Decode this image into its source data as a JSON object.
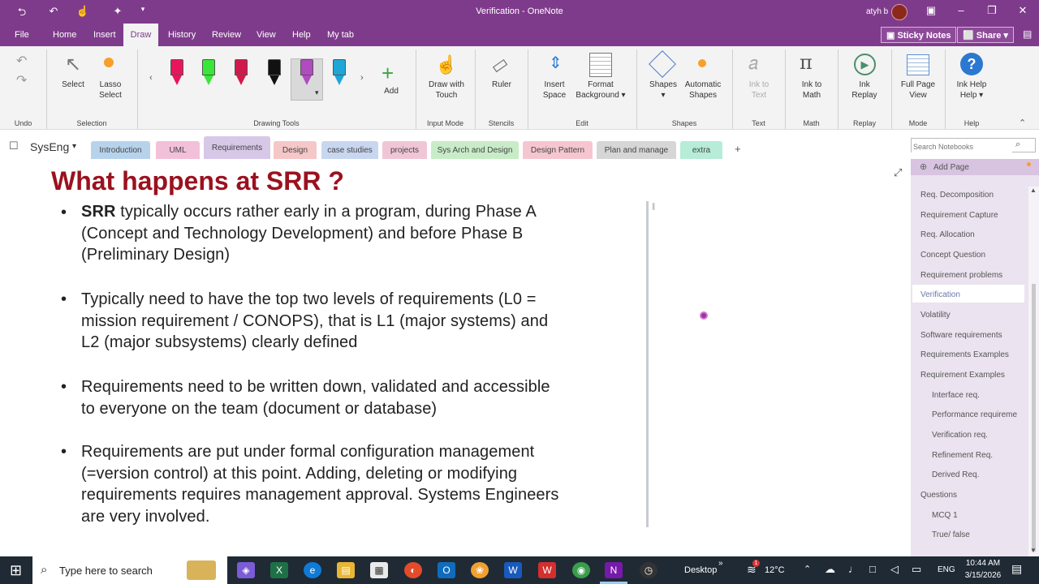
{
  "window": {
    "title": "Verification  -  OneNote",
    "user": "atyh b"
  },
  "menu_tabs": [
    "File",
    "Home",
    "Insert",
    "Draw",
    "History",
    "Review",
    "View",
    "Help",
    "My tab"
  ],
  "top_buttons": {
    "sticky_notes": "Sticky Notes",
    "share": "Share"
  },
  "ribbon": {
    "undo_group": "Undo",
    "select": "Select",
    "lasso_select": "Lasso Select",
    "selection_group": "Selection",
    "add": "Add",
    "drawing_tools_group": "Drawing Tools",
    "draw_with_touch": "Draw with Touch",
    "input_mode_group": "Input Mode",
    "ruler": "Ruler",
    "stencils_group": "Stencils",
    "insert_space": "Insert Space",
    "format_background": "Format Background",
    "edit_group": "Edit",
    "shapes": "Shapes",
    "automatic_shapes": "Automatic Shapes",
    "shapes_group": "Shapes",
    "ink_to_text": "Ink to Text",
    "text_group": "Text",
    "ink_to_math": "Ink to Math",
    "math_group": "Math",
    "ink_replay": "Ink Replay",
    "replay_group": "Replay",
    "full_page_view": "Full Page View",
    "mode_group": "Mode",
    "ink_help": "Ink Help",
    "help_group": "Help",
    "pen_colors": [
      "#e8155d",
      "#39e639",
      "#d11a4a",
      "#111111",
      "#b04cc0",
      "#1fa6d6"
    ]
  },
  "notebook": "SysEng",
  "section_tabs": [
    {
      "label": "Introduction",
      "color": "#b7d3ec"
    },
    {
      "label": "UML",
      "color": "#f3c0d9"
    },
    {
      "label": "Requirements",
      "color": "#d7c8e8"
    },
    {
      "label": "Design",
      "color": "#f5c7c7"
    },
    {
      "label": "case studies",
      "color": "#c8d6f0"
    },
    {
      "label": "projects",
      "color": "#f0c6d6"
    },
    {
      "label": "Sys Arch and Design",
      "color": "#c8ecc8"
    },
    {
      "label": "Design Pattern",
      "color": "#f6c6d0"
    },
    {
      "label": "Plan and manage",
      "color": "#d6d6d6"
    },
    {
      "label": "extra",
      "color": "#b6ecd8"
    }
  ],
  "search_placeholder": "Search Notebooks",
  "add_page": "Add Page",
  "pages": [
    {
      "label": "Req. Decomposition",
      "indent": false
    },
    {
      "label": "Requirement Capture",
      "indent": false
    },
    {
      "label": "Req. Allocation",
      "indent": false
    },
    {
      "label": "Concept Question",
      "indent": false
    },
    {
      "label": "Requirement problems",
      "indent": false
    },
    {
      "label": "Verification",
      "indent": false,
      "selected": true
    },
    {
      "label": "Volatility",
      "indent": false
    },
    {
      "label": "Software requirements",
      "indent": false
    },
    {
      "label": "Requirements Examples",
      "indent": false
    },
    {
      "label": "Requirement Examples",
      "indent": false
    },
    {
      "label": "Interface req.",
      "indent": true
    },
    {
      "label": "Performance requireme",
      "indent": true
    },
    {
      "label": "Verification req.",
      "indent": true
    },
    {
      "label": "Refinement Req.",
      "indent": true
    },
    {
      "label": "Derived Req.",
      "indent": true
    },
    {
      "label": "Questions",
      "indent": false
    },
    {
      "label": "MCQ 1",
      "indent": true
    },
    {
      "label": "True/ false",
      "indent": true
    }
  ],
  "page": {
    "heading": "What happens at SRR ?",
    "b1_bold": "SRR",
    "b1_lines": [
      " typically occurs rather early in a program, during Phase A",
      "(Concept and Technology Development) and before Phase B",
      "(Preliminary Design)"
    ],
    "b2_lines": [
      "Typically need to have the top two levels of requirements (L0 =",
      "mission requirement / CONOPS), that is L1 (major systems) and",
      "L2 (major subsystems) clearly defined"
    ],
    "b3_lines": [
      "Requirements need to be written down, validated and accessible",
      "to everyone on the team (document or database)"
    ],
    "b4_lines": [
      "Requirements are put under formal configuration management",
      "(=version control) at this point. Adding, deleting or modifying",
      "requirements requires management approval. Systems Engineers",
      "are very involved."
    ]
  },
  "taskbar": {
    "search": "Type here to search",
    "desktop": "Desktop",
    "temp": "12°C",
    "lang": "ENG",
    "time": "10:44 AM",
    "date": "3/15/2026"
  }
}
